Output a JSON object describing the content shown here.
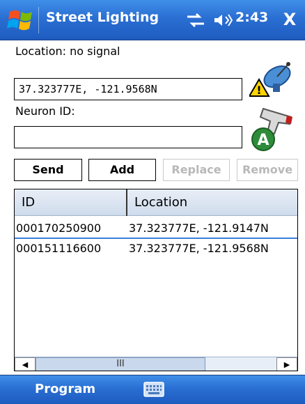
{
  "titlebar": {
    "app_title": "Street Lighting",
    "clock": "2:43",
    "close_label": "X"
  },
  "location": {
    "label": "Location:",
    "status": "no signal",
    "coordinates": "37.323777E, -121.9568N"
  },
  "neuron": {
    "label": "Neuron ID:",
    "value": ""
  },
  "buttons": {
    "send": "Send",
    "add": "Add",
    "replace": "Replace",
    "remove": "Remove"
  },
  "list": {
    "columns": [
      "ID",
      "Location"
    ],
    "rows": [
      {
        "id": "000170250900",
        "location": "37.323777E, -121.9147N"
      },
      {
        "id": "000151116600",
        "location": "37.323777E, -121.9568N"
      }
    ],
    "scroll_thumb_glyph": "III"
  },
  "bottombar": {
    "softkey_left": "Program"
  },
  "colors": {
    "bar_blue": "#2a6fd3",
    "selection_blue": "#3b7fd8"
  }
}
